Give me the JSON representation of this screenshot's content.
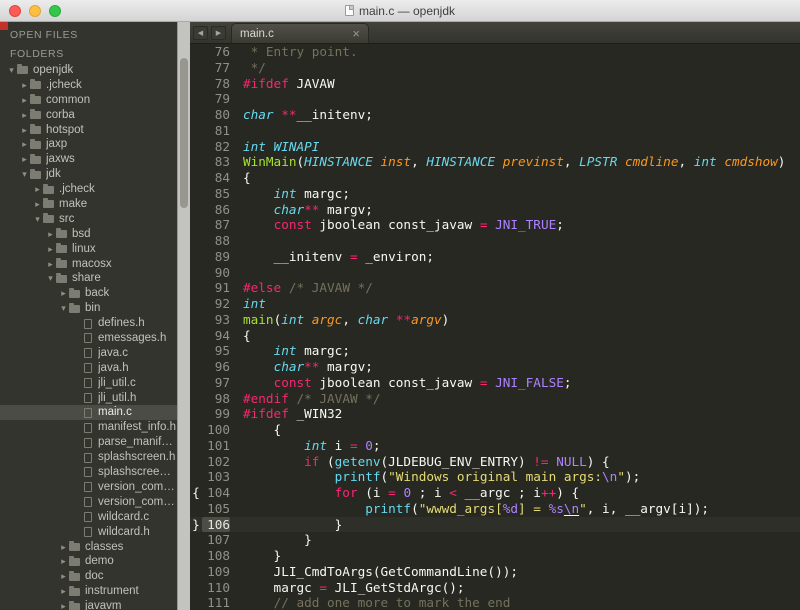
{
  "window": {
    "title": "main.c — openjdk"
  },
  "colors": {
    "editor-bg": "#272822",
    "fg": "#f8f8f2",
    "pink": "#f92672",
    "cyan": "#66d9ef",
    "green": "#a6e22e",
    "orange": "#fd971f",
    "yellow": "#e6db74",
    "purple": "#ae81ff",
    "comment": "#75715e",
    "gutter": "#90908a",
    "sidebar-bg": "#33342d",
    "selection": "#4b4c45"
  },
  "sidebar": {
    "open_files_header": "OPEN FILES",
    "folders_header": "FOLDERS",
    "tree": [
      {
        "label": "openjdk",
        "depth": 0,
        "kind": "folder",
        "expanded": true
      },
      {
        "label": ".jcheck",
        "depth": 1,
        "kind": "folder"
      },
      {
        "label": "common",
        "depth": 1,
        "kind": "folder"
      },
      {
        "label": "corba",
        "depth": 1,
        "kind": "folder"
      },
      {
        "label": "hotspot",
        "depth": 1,
        "kind": "folder"
      },
      {
        "label": "jaxp",
        "depth": 1,
        "kind": "folder"
      },
      {
        "label": "jaxws",
        "depth": 1,
        "kind": "folder"
      },
      {
        "label": "jdk",
        "depth": 1,
        "kind": "folder",
        "expanded": true
      },
      {
        "label": ".jcheck",
        "depth": 2,
        "kind": "folder"
      },
      {
        "label": "make",
        "depth": 2,
        "kind": "folder"
      },
      {
        "label": "src",
        "depth": 2,
        "kind": "folder",
        "expanded": true
      },
      {
        "label": "bsd",
        "depth": 3,
        "kind": "folder"
      },
      {
        "label": "linux",
        "depth": 3,
        "kind": "folder"
      },
      {
        "label": "macosx",
        "depth": 3,
        "kind": "folder"
      },
      {
        "label": "share",
        "depth": 3,
        "kind": "folder",
        "expanded": true
      },
      {
        "label": "back",
        "depth": 4,
        "kind": "folder"
      },
      {
        "label": "bin",
        "depth": 4,
        "kind": "folder",
        "expanded": true
      },
      {
        "label": "defines.h",
        "depth": 5,
        "kind": "file"
      },
      {
        "label": "emessages.h",
        "depth": 5,
        "kind": "file"
      },
      {
        "label": "java.c",
        "depth": 5,
        "kind": "file"
      },
      {
        "label": "java.h",
        "depth": 5,
        "kind": "file"
      },
      {
        "label": "jli_util.c",
        "depth": 5,
        "kind": "file"
      },
      {
        "label": "jli_util.h",
        "depth": 5,
        "kind": "file"
      },
      {
        "label": "main.c",
        "depth": 5,
        "kind": "file",
        "selected": true
      },
      {
        "label": "manifest_info.h",
        "depth": 5,
        "kind": "file"
      },
      {
        "label": "parse_manifest.c",
        "depth": 5,
        "kind": "file"
      },
      {
        "label": "splashscreen.h",
        "depth": 5,
        "kind": "file"
      },
      {
        "label": "splashscreen_stubs.c",
        "depth": 5,
        "kind": "file"
      },
      {
        "label": "version_comp.c",
        "depth": 5,
        "kind": "file"
      },
      {
        "label": "version_comp.h",
        "depth": 5,
        "kind": "file"
      },
      {
        "label": "wildcard.c",
        "depth": 5,
        "kind": "file"
      },
      {
        "label": "wildcard.h",
        "depth": 5,
        "kind": "file"
      },
      {
        "label": "classes",
        "depth": 4,
        "kind": "folder"
      },
      {
        "label": "demo",
        "depth": 4,
        "kind": "folder"
      },
      {
        "label": "doc",
        "depth": 4,
        "kind": "folder"
      },
      {
        "label": "instrument",
        "depth": 4,
        "kind": "folder"
      },
      {
        "label": "javavm",
        "depth": 4,
        "kind": "folder"
      }
    ]
  },
  "tabbar": {
    "back_icon": "◀",
    "forward_icon": "▶",
    "tabs": [
      {
        "label": "main.c",
        "close_icon": "×",
        "active": true
      }
    ]
  },
  "editor": {
    "lines": [
      {
        "n": 76,
        "seg": [
          [
            "cm",
            " * Entry point."
          ]
        ]
      },
      {
        "n": 77,
        "seg": [
          [
            "cm",
            " */"
          ]
        ]
      },
      {
        "n": 78,
        "seg": [
          [
            "p",
            "#ifdef"
          ],
          [
            "w",
            " JAVAW"
          ]
        ]
      },
      {
        "n": 79,
        "seg": []
      },
      {
        "n": 80,
        "seg": [
          [
            "ci",
            "char"
          ],
          [
            "w",
            " "
          ],
          [
            "p",
            "**"
          ],
          [
            "w",
            "__initenv;"
          ]
        ]
      },
      {
        "n": 81,
        "seg": []
      },
      {
        "n": 82,
        "seg": [
          [
            "ci",
            "int"
          ],
          [
            "w",
            " "
          ],
          [
            "ci",
            "WINAPI"
          ]
        ]
      },
      {
        "n": 83,
        "seg": [
          [
            "g",
            "WinMain"
          ],
          [
            "w",
            "("
          ],
          [
            "ci",
            "HINSTANCE"
          ],
          [
            "w",
            " "
          ],
          [
            "oi",
            "inst"
          ],
          [
            "w",
            ", "
          ],
          [
            "ci",
            "HINSTANCE"
          ],
          [
            "w",
            " "
          ],
          [
            "oi",
            "previnst"
          ],
          [
            "w",
            ", "
          ],
          [
            "ci",
            "LPSTR"
          ],
          [
            "w",
            " "
          ],
          [
            "oi",
            "cmdline"
          ],
          [
            "w",
            ", "
          ],
          [
            "ci",
            "int"
          ],
          [
            "w",
            " "
          ],
          [
            "oi",
            "cmdshow"
          ],
          [
            "w",
            ")"
          ]
        ]
      },
      {
        "n": 84,
        "seg": [
          [
            "w",
            "{"
          ]
        ]
      },
      {
        "n": 85,
        "seg": [
          [
            "w",
            "    "
          ],
          [
            "ci",
            "int"
          ],
          [
            "w",
            " margc;"
          ]
        ]
      },
      {
        "n": 86,
        "seg": [
          [
            "w",
            "    "
          ],
          [
            "ci",
            "char"
          ],
          [
            "p",
            "**"
          ],
          [
            "w",
            " margv;"
          ]
        ]
      },
      {
        "n": 87,
        "seg": [
          [
            "w",
            "    "
          ],
          [
            "p",
            "const"
          ],
          [
            "w",
            " jboolean const_javaw "
          ],
          [
            "p",
            "="
          ],
          [
            "w",
            " "
          ],
          [
            "v",
            "JNI_TRUE"
          ],
          [
            "w",
            ";"
          ]
        ]
      },
      {
        "n": 88,
        "seg": []
      },
      {
        "n": 89,
        "seg": [
          [
            "w",
            "    __initenv "
          ],
          [
            "p",
            "="
          ],
          [
            "w",
            " _environ;"
          ]
        ]
      },
      {
        "n": 90,
        "seg": []
      },
      {
        "n": 91,
        "seg": [
          [
            "p",
            "#else"
          ],
          [
            "w",
            " "
          ],
          [
            "cm",
            "/* JAVAW */"
          ]
        ]
      },
      {
        "n": 92,
        "seg": [
          [
            "ci",
            "int"
          ]
        ]
      },
      {
        "n": 93,
        "seg": [
          [
            "g",
            "main"
          ],
          [
            "w",
            "("
          ],
          [
            "ci",
            "int"
          ],
          [
            "w",
            " "
          ],
          [
            "oi",
            "argc"
          ],
          [
            "w",
            ", "
          ],
          [
            "ci",
            "char"
          ],
          [
            "w",
            " "
          ],
          [
            "p",
            "**"
          ],
          [
            "oi",
            "argv"
          ],
          [
            "w",
            ")"
          ]
        ]
      },
      {
        "n": 94,
        "seg": [
          [
            "w",
            "{"
          ]
        ]
      },
      {
        "n": 95,
        "seg": [
          [
            "w",
            "    "
          ],
          [
            "ci",
            "int"
          ],
          [
            "w",
            " margc;"
          ]
        ]
      },
      {
        "n": 96,
        "seg": [
          [
            "w",
            "    "
          ],
          [
            "ci",
            "char"
          ],
          [
            "p",
            "**"
          ],
          [
            "w",
            " margv;"
          ]
        ]
      },
      {
        "n": 97,
        "seg": [
          [
            "w",
            "    "
          ],
          [
            "p",
            "const"
          ],
          [
            "w",
            " jboolean const_javaw "
          ],
          [
            "p",
            "="
          ],
          [
            "w",
            " "
          ],
          [
            "v",
            "JNI_FALSE"
          ],
          [
            "w",
            ";"
          ]
        ]
      },
      {
        "n": 98,
        "seg": [
          [
            "p",
            "#endif"
          ],
          [
            "w",
            " "
          ],
          [
            "cm",
            "/* JAVAW */"
          ]
        ]
      },
      {
        "n": 99,
        "seg": [
          [
            "p",
            "#ifdef"
          ],
          [
            "w",
            " _WIN32"
          ]
        ]
      },
      {
        "n": 100,
        "seg": [
          [
            "w",
            "    {"
          ]
        ]
      },
      {
        "n": 101,
        "seg": [
          [
            "w",
            "        "
          ],
          [
            "ci",
            "int"
          ],
          [
            "w",
            " i "
          ],
          [
            "p",
            "="
          ],
          [
            "w",
            " "
          ],
          [
            "v",
            "0"
          ],
          [
            "w",
            ";"
          ]
        ]
      },
      {
        "n": 102,
        "seg": [
          [
            "w",
            "        "
          ],
          [
            "p",
            "if"
          ],
          [
            "w",
            " ("
          ],
          [
            "c",
            "getenv"
          ],
          [
            "w",
            "(JLDEBUG_ENV_ENTRY) "
          ],
          [
            "p",
            "!="
          ],
          [
            "w",
            " "
          ],
          [
            "v",
            "NULL"
          ],
          [
            "w",
            ") {"
          ]
        ]
      },
      {
        "n": 103,
        "seg": [
          [
            "w",
            "            "
          ],
          [
            "c",
            "printf"
          ],
          [
            "w",
            "("
          ],
          [
            "y",
            "\"Windows original main args:"
          ],
          [
            "v",
            "\\n"
          ],
          [
            "y",
            "\""
          ],
          [
            "w",
            ");"
          ]
        ]
      },
      {
        "n": 104,
        "mark": "{",
        "seg": [
          [
            "w",
            "            "
          ],
          [
            "p",
            "for"
          ],
          [
            "w",
            " (i "
          ],
          [
            "p",
            "="
          ],
          [
            "w",
            " "
          ],
          [
            "v",
            "0"
          ],
          [
            "w",
            " ; i "
          ],
          [
            "p",
            "<"
          ],
          [
            "w",
            " __argc ; i"
          ],
          [
            "p",
            "++"
          ],
          [
            "w",
            ") {"
          ]
        ]
      },
      {
        "n": 105,
        "seg": [
          [
            "w",
            "                "
          ],
          [
            "c",
            "printf"
          ],
          [
            "w",
            "("
          ],
          [
            "y",
            "\"wwwd_args["
          ],
          [
            "v",
            "%d"
          ],
          [
            "y",
            "] = "
          ],
          [
            "v",
            "%s"
          ],
          [
            "vu",
            "\\n"
          ],
          [
            "y",
            "\""
          ],
          [
            "w",
            ", i, __argv[i]);"
          ]
        ]
      },
      {
        "n": 106,
        "mark": "}",
        "cur": true,
        "seg": [
          [
            "w",
            "            }"
          ]
        ]
      },
      {
        "n": 107,
        "seg": [
          [
            "w",
            "        }"
          ]
        ]
      },
      {
        "n": 108,
        "seg": [
          [
            "w",
            "    }"
          ]
        ]
      },
      {
        "n": 109,
        "seg": [
          [
            "w",
            "    JLI_CmdToArgs(GetCommandLine());"
          ]
        ]
      },
      {
        "n": 110,
        "seg": [
          [
            "w",
            "    margc "
          ],
          [
            "p",
            "="
          ],
          [
            "w",
            " JLI_GetStdArgc();"
          ]
        ]
      },
      {
        "n": 111,
        "seg": [
          [
            "w",
            "    "
          ],
          [
            "cm",
            "// add one more to mark the end"
          ]
        ]
      }
    ]
  }
}
